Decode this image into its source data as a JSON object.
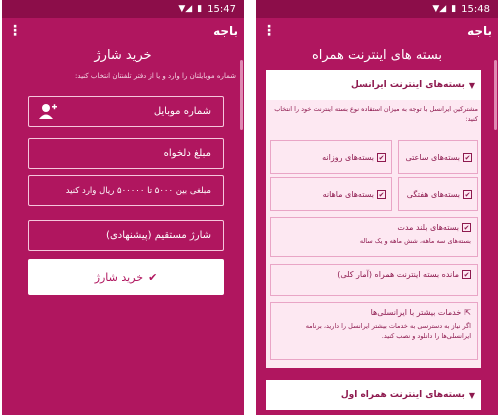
{
  "left": {
    "status_time": "15:47",
    "brand": "باجه",
    "title": "خرید شارژ",
    "hint": "شماره موبایلتان را وارد و یا از دفتر تلفنتان انتخاب کنید:",
    "mobile_placeholder": "شماره موبایل",
    "amount_placeholder": "مبلغ دلخواه",
    "amount_range": "مبلغی بین ۵۰۰۰ تا ۵۰۰۰۰۰ ریال وارد کنید",
    "charge_type": "شارژ مستقیم (پیشنهادی)",
    "buy_label": "خرید شارژ",
    "buy_icon": "check-icon",
    "add_contact_icon": "add-contact-icon"
  },
  "right": {
    "status_time": "15:48",
    "brand": "باجه",
    "title": "بسته های اینترنت همراه",
    "irancell_header": "بسته‌های اینترنت ایرانسل",
    "irancell_desc": "مشترکین ایرانسل با توجه به میزان استفاده نوع بسته اینترنت خود را انتخاب کنید:",
    "tiles": [
      "بسته‌های ساعتی",
      "بسته‌های روزانه",
      "بسته‌های هفتگی",
      "بسته‌های ماهانه"
    ],
    "long_term_title": "بسته‌های بلند مدت",
    "long_term_desc": "بسته‌های سه ماهه، شش ماهه و یک ساله",
    "remaining_title": "مانده بسته اینترنت همراه (آمار کلی)",
    "more_title": "خدمات بیشتر با ایرانسلی‌ها",
    "more_desc": "اگر نیاز به دسترسی به خدمات بیشتر ایرانسل را دارید، برنامه ایرانسلی‌ها را دانلود و نصب کنید.",
    "hamrah_header": "بسته‌های اینترنت همراه اول"
  },
  "colors": {
    "primary": "#b0165f",
    "statusbar": "#8c0d49",
    "card": "#fde8f2",
    "text_dark": "#8e1a4f"
  }
}
